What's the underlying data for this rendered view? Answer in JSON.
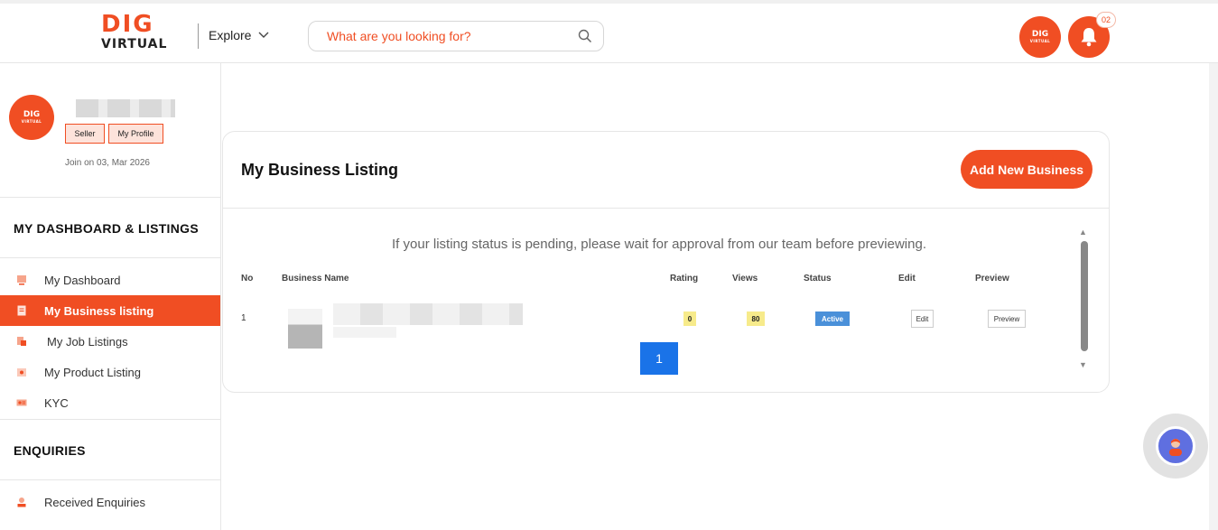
{
  "header": {
    "logo_top": "DIG",
    "logo_bottom": "VIRTUAL",
    "explore_label": "Explore",
    "search_placeholder": "What are you looking for?",
    "notification_count": "02",
    "avatar_logo_top": "DIG",
    "avatar_logo_bottom": "VIRTUAL"
  },
  "profile": {
    "avatar_logo_top": "DIG",
    "avatar_logo_bottom": "VIRTUAL",
    "seller_label": "Seller",
    "my_profile_label": "My Profile",
    "join_text": "Join on 03, Mar 2026"
  },
  "sidebar": {
    "dashboard_heading": "MY DASHBOARD & LISTINGS",
    "items": [
      {
        "label": "My Dashboard",
        "icon": "dashboard-icon"
      },
      {
        "label": "My Business listing",
        "icon": "document-icon",
        "active": true
      },
      {
        "label": "My Job Listings",
        "icon": "jobs-icon"
      },
      {
        "label": "My Product Listing",
        "icon": "product-icon"
      },
      {
        "label": "KYC",
        "icon": "id-card-icon"
      }
    ],
    "enquiries_heading": "ENQUIRIES",
    "enquiry_items": [
      {
        "label": "Received Enquiries",
        "icon": "person-icon"
      }
    ]
  },
  "main": {
    "title": "My Business Listing",
    "add_button": "Add New Business",
    "notice": "If your listing status is pending, please wait for approval from our team before previewing.",
    "columns": [
      "No",
      "Business Name",
      "Rating",
      "Views",
      "Status",
      "Edit",
      "Preview"
    ],
    "rows": [
      {
        "no": "1",
        "rating": "0",
        "views": "80",
        "status": "Active",
        "edit": "Edit",
        "preview": "Preview"
      }
    ],
    "pagination": {
      "current": "1"
    }
  },
  "colors": {
    "brand": "#f04e23",
    "active_status": "#4a90d9",
    "page_button": "#1a73e8"
  }
}
